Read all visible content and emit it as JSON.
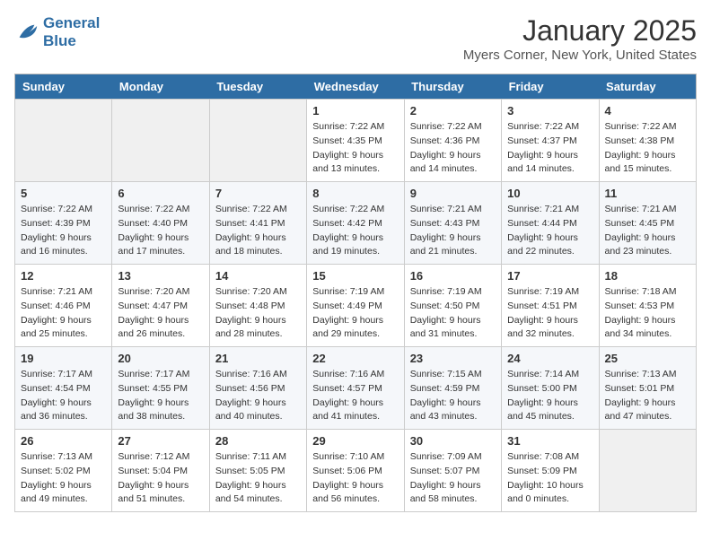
{
  "header": {
    "logo_line1": "General",
    "logo_line2": "Blue",
    "month": "January 2025",
    "location": "Myers Corner, New York, United States"
  },
  "weekdays": [
    "Sunday",
    "Monday",
    "Tuesday",
    "Wednesday",
    "Thursday",
    "Friday",
    "Saturday"
  ],
  "weeks": [
    [
      {
        "num": "",
        "info": ""
      },
      {
        "num": "",
        "info": ""
      },
      {
        "num": "",
        "info": ""
      },
      {
        "num": "1",
        "info": "Sunrise: 7:22 AM\nSunset: 4:35 PM\nDaylight: 9 hours and 13 minutes."
      },
      {
        "num": "2",
        "info": "Sunrise: 7:22 AM\nSunset: 4:36 PM\nDaylight: 9 hours and 14 minutes."
      },
      {
        "num": "3",
        "info": "Sunrise: 7:22 AM\nSunset: 4:37 PM\nDaylight: 9 hours and 14 minutes."
      },
      {
        "num": "4",
        "info": "Sunrise: 7:22 AM\nSunset: 4:38 PM\nDaylight: 9 hours and 15 minutes."
      }
    ],
    [
      {
        "num": "5",
        "info": "Sunrise: 7:22 AM\nSunset: 4:39 PM\nDaylight: 9 hours and 16 minutes."
      },
      {
        "num": "6",
        "info": "Sunrise: 7:22 AM\nSunset: 4:40 PM\nDaylight: 9 hours and 17 minutes."
      },
      {
        "num": "7",
        "info": "Sunrise: 7:22 AM\nSunset: 4:41 PM\nDaylight: 9 hours and 18 minutes."
      },
      {
        "num": "8",
        "info": "Sunrise: 7:22 AM\nSunset: 4:42 PM\nDaylight: 9 hours and 19 minutes."
      },
      {
        "num": "9",
        "info": "Sunrise: 7:21 AM\nSunset: 4:43 PM\nDaylight: 9 hours and 21 minutes."
      },
      {
        "num": "10",
        "info": "Sunrise: 7:21 AM\nSunset: 4:44 PM\nDaylight: 9 hours and 22 minutes."
      },
      {
        "num": "11",
        "info": "Sunrise: 7:21 AM\nSunset: 4:45 PM\nDaylight: 9 hours and 23 minutes."
      }
    ],
    [
      {
        "num": "12",
        "info": "Sunrise: 7:21 AM\nSunset: 4:46 PM\nDaylight: 9 hours and 25 minutes."
      },
      {
        "num": "13",
        "info": "Sunrise: 7:20 AM\nSunset: 4:47 PM\nDaylight: 9 hours and 26 minutes."
      },
      {
        "num": "14",
        "info": "Sunrise: 7:20 AM\nSunset: 4:48 PM\nDaylight: 9 hours and 28 minutes."
      },
      {
        "num": "15",
        "info": "Sunrise: 7:19 AM\nSunset: 4:49 PM\nDaylight: 9 hours and 29 minutes."
      },
      {
        "num": "16",
        "info": "Sunrise: 7:19 AM\nSunset: 4:50 PM\nDaylight: 9 hours and 31 minutes."
      },
      {
        "num": "17",
        "info": "Sunrise: 7:19 AM\nSunset: 4:51 PM\nDaylight: 9 hours and 32 minutes."
      },
      {
        "num": "18",
        "info": "Sunrise: 7:18 AM\nSunset: 4:53 PM\nDaylight: 9 hours and 34 minutes."
      }
    ],
    [
      {
        "num": "19",
        "info": "Sunrise: 7:17 AM\nSunset: 4:54 PM\nDaylight: 9 hours and 36 minutes."
      },
      {
        "num": "20",
        "info": "Sunrise: 7:17 AM\nSunset: 4:55 PM\nDaylight: 9 hours and 38 minutes."
      },
      {
        "num": "21",
        "info": "Sunrise: 7:16 AM\nSunset: 4:56 PM\nDaylight: 9 hours and 40 minutes."
      },
      {
        "num": "22",
        "info": "Sunrise: 7:16 AM\nSunset: 4:57 PM\nDaylight: 9 hours and 41 minutes."
      },
      {
        "num": "23",
        "info": "Sunrise: 7:15 AM\nSunset: 4:59 PM\nDaylight: 9 hours and 43 minutes."
      },
      {
        "num": "24",
        "info": "Sunrise: 7:14 AM\nSunset: 5:00 PM\nDaylight: 9 hours and 45 minutes."
      },
      {
        "num": "25",
        "info": "Sunrise: 7:13 AM\nSunset: 5:01 PM\nDaylight: 9 hours and 47 minutes."
      }
    ],
    [
      {
        "num": "26",
        "info": "Sunrise: 7:13 AM\nSunset: 5:02 PM\nDaylight: 9 hours and 49 minutes."
      },
      {
        "num": "27",
        "info": "Sunrise: 7:12 AM\nSunset: 5:04 PM\nDaylight: 9 hours and 51 minutes."
      },
      {
        "num": "28",
        "info": "Sunrise: 7:11 AM\nSunset: 5:05 PM\nDaylight: 9 hours and 54 minutes."
      },
      {
        "num": "29",
        "info": "Sunrise: 7:10 AM\nSunset: 5:06 PM\nDaylight: 9 hours and 56 minutes."
      },
      {
        "num": "30",
        "info": "Sunrise: 7:09 AM\nSunset: 5:07 PM\nDaylight: 9 hours and 58 minutes."
      },
      {
        "num": "31",
        "info": "Sunrise: 7:08 AM\nSunset: 5:09 PM\nDaylight: 10 hours and 0 minutes."
      },
      {
        "num": "",
        "info": ""
      }
    ]
  ]
}
